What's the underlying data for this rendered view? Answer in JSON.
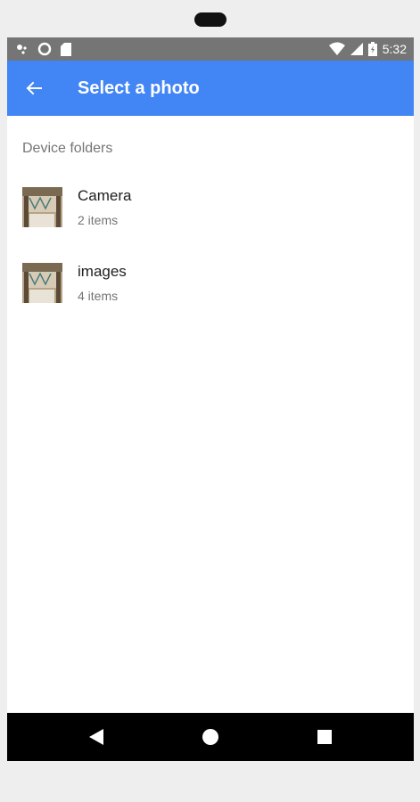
{
  "status_bar": {
    "time": "5:32",
    "icons": [
      "notification-dots-icon",
      "sync-icon",
      "sd-card-icon",
      "wifi-icon",
      "cell-signal-icon",
      "battery-icon"
    ]
  },
  "app_bar": {
    "back_icon": "arrow-back-icon",
    "title": "Select a photo",
    "color": "#4285f4"
  },
  "section": {
    "header": "Device folders"
  },
  "folders": [
    {
      "name": "Camera",
      "count": "2 items"
    },
    {
      "name": "images",
      "count": "4 items"
    }
  ],
  "nav_bar": {
    "buttons": [
      "back-triangle-icon",
      "home-circle-icon",
      "recents-square-icon"
    ]
  }
}
